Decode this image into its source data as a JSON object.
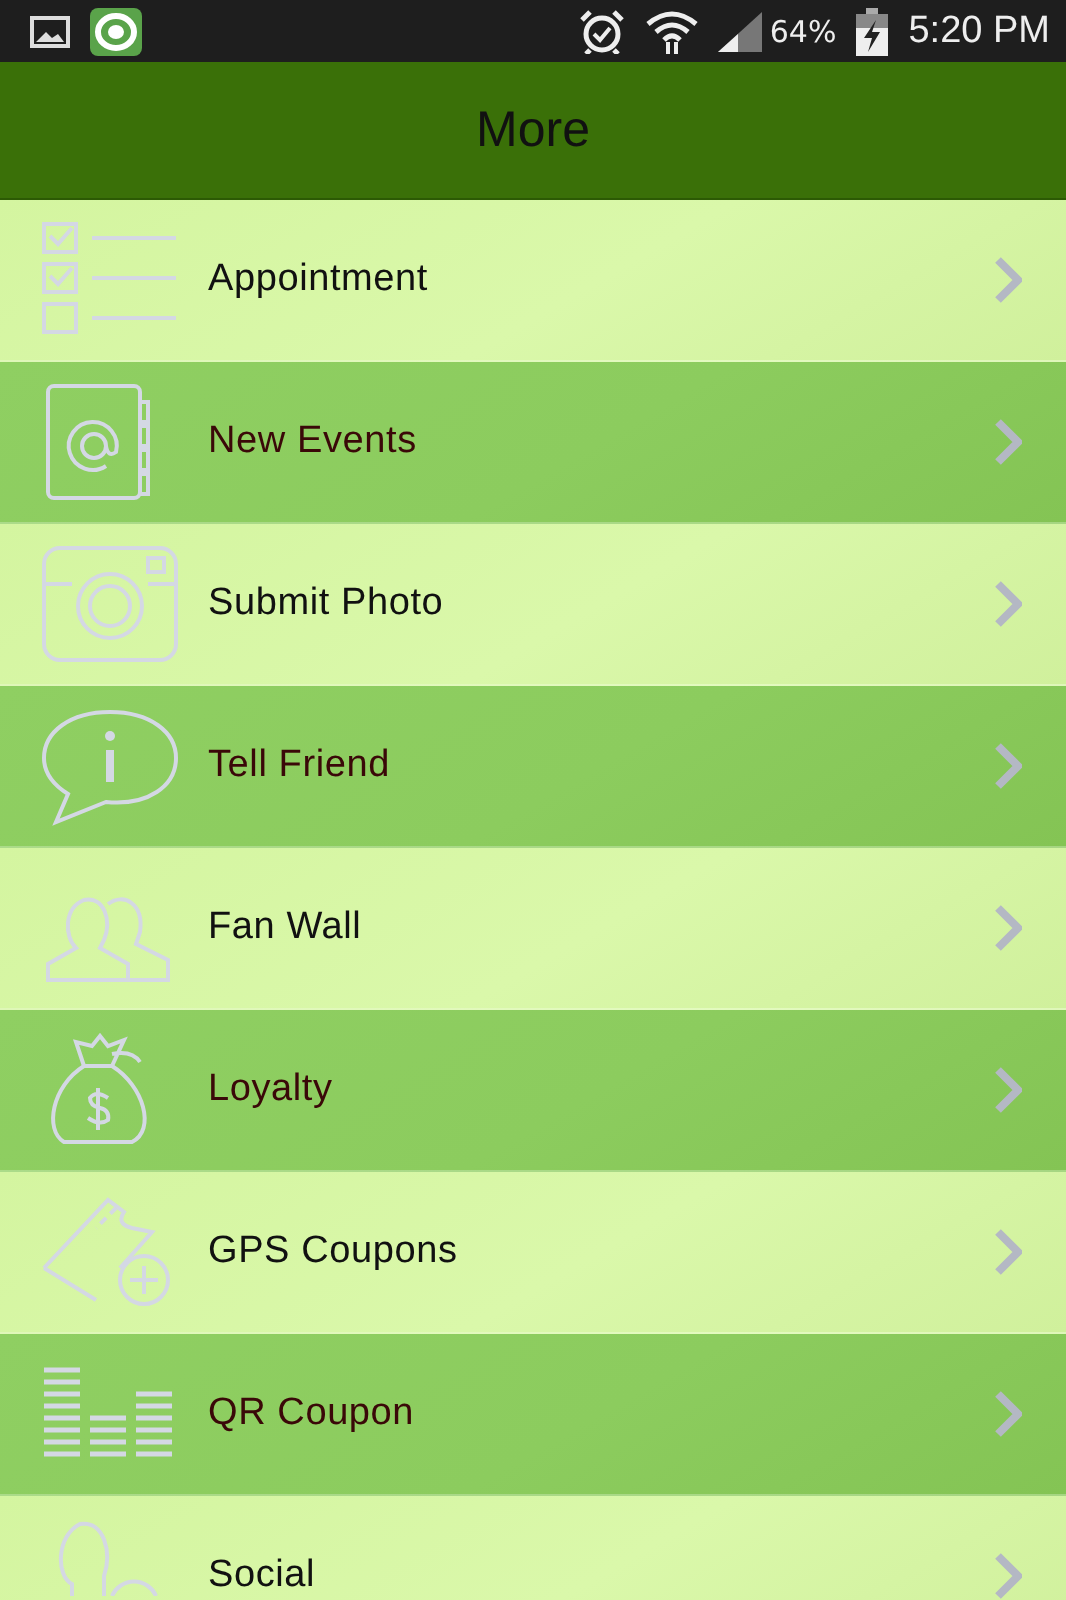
{
  "status_bar": {
    "battery_text": "64%",
    "time": "5:20 PM"
  },
  "header": {
    "title": "More"
  },
  "menu": [
    {
      "label": "Appointment"
    },
    {
      "label": "New Events"
    },
    {
      "label": "Submit Photo"
    },
    {
      "label": "Tell Friend"
    },
    {
      "label": "Fan Wall"
    },
    {
      "label": "Loyalty"
    },
    {
      "label": "GPS Coupons"
    },
    {
      "label": "QR Coupon"
    },
    {
      "label": "Social"
    }
  ]
}
